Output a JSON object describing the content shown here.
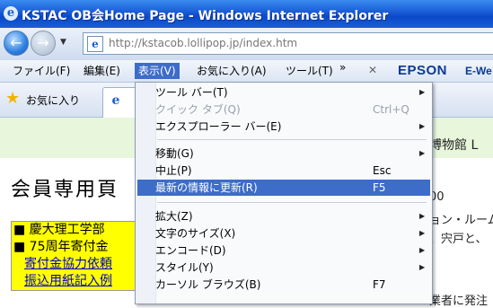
{
  "window": {
    "title": "KSTAC OB会Home Page - Windows Internet Explorer"
  },
  "address": {
    "url": "http://kstacob.lollipop.jp/index.htm"
  },
  "menubar": {
    "items": [
      "ファイル(F)",
      "編集(E)",
      "表示(V)",
      "お気に入り(A)",
      "ツール(T)"
    ],
    "overflow": "»",
    "close": "✕",
    "epson": "EPSON",
    "epson_more": "E-We"
  },
  "favorites": {
    "label": "お気に入り"
  },
  "page": {
    "band_text": "博物館 L",
    "heading": "会員専用頁",
    "lines": [
      "■ 慶大理工学部",
      "■ 75周年寄付金"
    ],
    "links": [
      "寄付金協力依頼",
      "振込用紙記入例"
    ],
    "right_texts": [
      "00",
      "ョン・ルーム",
      "、宍戸と、",
      "業者に発注"
    ]
  },
  "view_menu": {
    "items": [
      {
        "label": "ツール バー(T)",
        "shortcut": "",
        "submenu": true,
        "disabled": false
      },
      {
        "label": "クイック タブ(Q)",
        "shortcut": "Ctrl+Q",
        "submenu": false,
        "disabled": true
      },
      {
        "label": "エクスプローラー バー(E)",
        "shortcut": "",
        "submenu": true,
        "disabled": false
      },
      {
        "label": "移動(G)",
        "shortcut": "",
        "submenu": true,
        "disabled": false
      },
      {
        "label": "中止(P)",
        "shortcut": "Esc",
        "submenu": false,
        "disabled": false
      },
      {
        "label": "最新の情報に更新(R)",
        "shortcut": "F5",
        "submenu": false,
        "disabled": false,
        "highlighted": true
      },
      {
        "label": "拡大(Z)",
        "shortcut": "",
        "submenu": true,
        "disabled": false
      },
      {
        "label": "文字のサイズ(X)",
        "shortcut": "",
        "submenu": true,
        "disabled": false
      },
      {
        "label": "エンコード(D)",
        "shortcut": "",
        "submenu": true,
        "disabled": false
      },
      {
        "label": "スタイル(Y)",
        "shortcut": "",
        "submenu": true,
        "disabled": false
      },
      {
        "label": "カーソル ブラウズ(B)",
        "shortcut": "F7",
        "submenu": false,
        "disabled": false
      }
    ]
  }
}
